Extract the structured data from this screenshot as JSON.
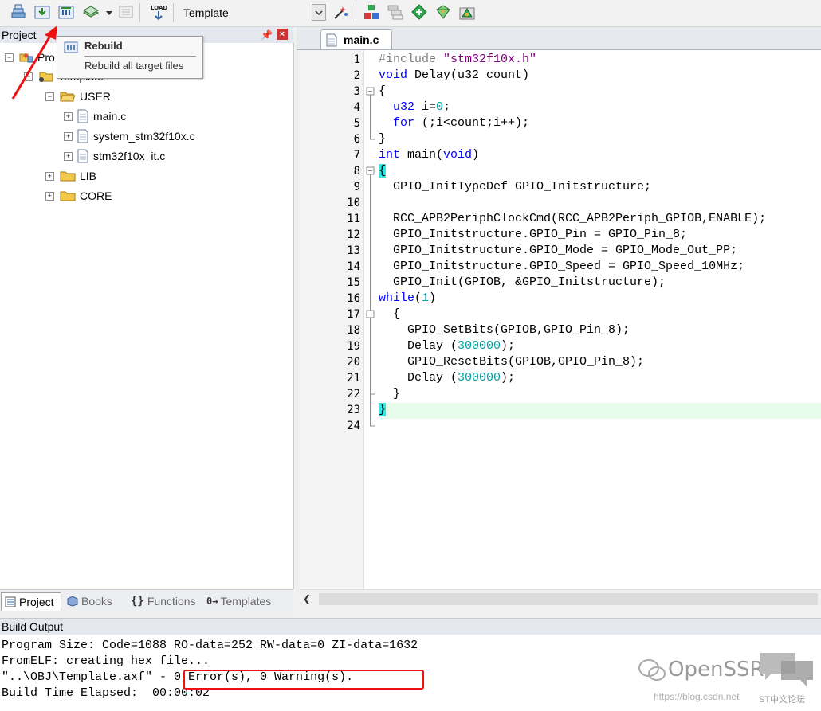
{
  "toolbar": {
    "target": "Template",
    "load_label": "LOAD",
    "icons": [
      "translate-icon",
      "build-icon",
      "rebuild-icon",
      "batch-build-icon",
      "dropdown-arrow-icon",
      "stop-build-icon",
      "download-icon",
      "target-options-icon",
      "manage-components-icon",
      "select-packs-icon",
      "pack-installer-icon",
      "event-recorder-icon",
      "env-icon"
    ]
  },
  "tooltip": {
    "title": "Rebuild",
    "description": "Rebuild all target files"
  },
  "project_panel": {
    "title": "Project",
    "root": "Pro",
    "target": "Template",
    "groups": [
      {
        "label": "USER",
        "files": [
          "main.c",
          "system_stm32f10x.c",
          "stm32f10x_it.c"
        ]
      },
      {
        "label": "LIB"
      },
      {
        "label": "CORE"
      }
    ]
  },
  "left_tabs": [
    {
      "label": "Project"
    },
    {
      "label": "Books"
    },
    {
      "label": "Functions"
    },
    {
      "label": "Templates"
    }
  ],
  "editor": {
    "tab": "main.c",
    "lines": [
      "#include \"stm32f10x.h\"",
      "void Delay(u32 count)",
      "{",
      "  u32 i=0;",
      "  for (;i<count;i++);",
      "}",
      "int main(void)",
      "{",
      "  GPIO_InitTypeDef GPIO_Initstructure;",
      "",
      "  RCC_APB2PeriphClockCmd(RCC_APB2Periph_GPIOB,ENABLE);",
      "  GPIO_Initstructure.GPIO_Pin = GPIO_Pin_8;",
      "  GPIO_Initstructure.GPIO_Mode = GPIO_Mode_Out_PP;",
      "  GPIO_Initstructure.GPIO_Speed = GPIO_Speed_10MHz;",
      "  GPIO_Init(GPIOB, &GPIO_Initstructure);",
      "while(1)",
      "  {",
      "    GPIO_SetBits(GPIOB,GPIO_Pin_8);",
      "    Delay (300000);",
      "    GPIO_ResetBits(GPIOB,GPIO_Pin_8);",
      "    Delay (300000);",
      "  }",
      "}",
      ""
    ]
  },
  "build_output": {
    "title": "Build Output",
    "lines": [
      "Program Size: Code=1088 RO-data=252 RW-data=0 ZI-data=1632",
      "FromELF: creating hex file...",
      "\"..\\OBJ\\Template.axf\" - 0 Error(s), 0 Warning(s).",
      "Build Time Elapsed:  00:00:02"
    ]
  },
  "watermark": {
    "brand": "OpenSSR",
    "url": "https://blog.csdn.net",
    "forum": "ST中文论坛"
  },
  "colors": {
    "keyword": "#0000ff",
    "preprocessor": "#808080",
    "string": "#800080",
    "number": "#00a0a0",
    "current_line": "#e6fbe9",
    "annotation": "#ee1111"
  }
}
